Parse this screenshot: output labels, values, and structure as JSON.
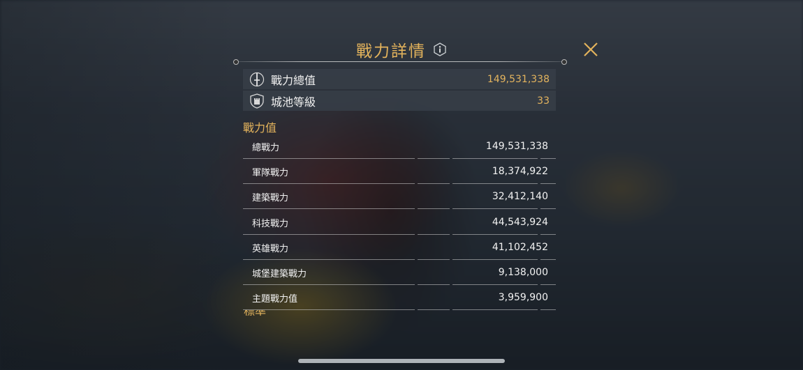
{
  "header": {
    "title": "戰力詳情"
  },
  "summary": [
    {
      "label": "戰力總值",
      "value": "149,531,338",
      "icon": "sword-icon"
    },
    {
      "label": "城池等級",
      "value": "33",
      "icon": "castle-shield-icon"
    }
  ],
  "section": {
    "title": "戰力值",
    "rows": [
      {
        "label": "總戰力",
        "value": "149,531,338"
      },
      {
        "label": "軍隊戰力",
        "value": "18,374,922"
      },
      {
        "label": "建築戰力",
        "value": "32,412,140"
      },
      {
        "label": "科技戰力",
        "value": "44,543,924"
      },
      {
        "label": "英雄戰力",
        "value": "41,102,452"
      },
      {
        "label": "城堡建築戰力",
        "value": "9,138,000"
      },
      {
        "label": "主題戰力值",
        "value": "3,959,900"
      }
    ],
    "next_title_partial": "標準"
  },
  "colors": {
    "accent_gold": "#e3b35c",
    "value_gold": "#e4b45e",
    "text": "#f2f2f2"
  }
}
